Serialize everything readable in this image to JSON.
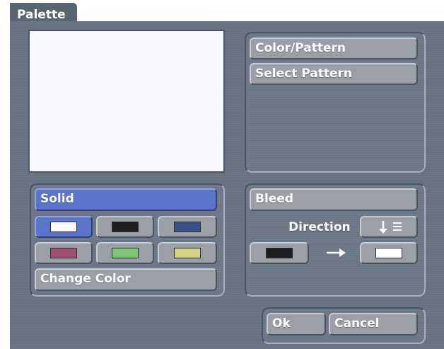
{
  "dialog": {
    "title": "Palette"
  },
  "pattern_panel": {
    "color_pattern_label": "Color/Pattern",
    "select_pattern_label": "Select Pattern"
  },
  "fill_panel": {
    "solid_label": "Solid",
    "change_color_label": "Change Color",
    "swatches": [
      {
        "color": "#ffffff",
        "selected": true
      },
      {
        "color": "#1e1e1e",
        "selected": false
      },
      {
        "color": "#3c5088",
        "selected": false
      },
      {
        "color": "#a0506e",
        "selected": false
      },
      {
        "color": "#7cc870",
        "selected": false
      },
      {
        "color": "#d2d282",
        "selected": false
      }
    ]
  },
  "bleed_panel": {
    "bleed_label": "Bleed",
    "direction_label": "Direction",
    "direction_icon": "arrow-down-lines-icon",
    "from_color": "#1e1e1e",
    "to_color": "#ffffff",
    "arrow_icon": "arrow-right-icon"
  },
  "actions": {
    "ok_label": "Ok",
    "cancel_label": "Cancel"
  },
  "colors": {
    "window": "#667182",
    "button": "#9aa0a6",
    "selected": "#5b73c8",
    "preview": "#f7f8fc"
  }
}
